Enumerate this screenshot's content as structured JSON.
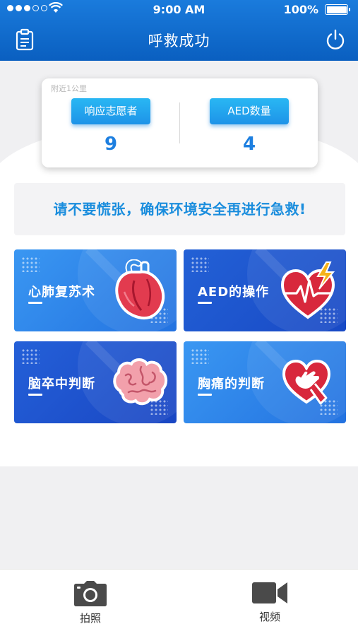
{
  "status_bar": {
    "time": "9:00 AM",
    "battery": "100%",
    "battery_level": 1.0,
    "signal_bars_filled": 3,
    "signal_bars_total": 5
  },
  "navbar": {
    "title": "呼救成功",
    "left_icon": "clipboard-icon",
    "right_icon": "power-icon"
  },
  "stats": {
    "scope": "附近1公里",
    "volunteers": {
      "label": "响应志愿者",
      "value": "9"
    },
    "aed": {
      "label": "AED数量",
      "value": "4"
    }
  },
  "notice": "请不要慌张，确保环境安全再进行急救!",
  "cards": [
    {
      "label": "心肺复苏术",
      "icon": "heart-organ-icon"
    },
    {
      "label": "AED的操作",
      "icon": "aed-heart-icon"
    },
    {
      "label": "脑卒中判断",
      "icon": "brain-icon"
    },
    {
      "label": "胸痛的判断",
      "icon": "chest-pain-hand-icon"
    }
  ],
  "tabs": [
    {
      "label": "拍照",
      "icon": "camera-icon"
    },
    {
      "label": "视频",
      "icon": "video-icon"
    }
  ],
  "colors": {
    "header": "#1a7bdc",
    "accent": "#1d7fe0",
    "notice_text": "#1a8ddd",
    "card_light": "#3a97f2",
    "card_dark": "#1849c5"
  }
}
